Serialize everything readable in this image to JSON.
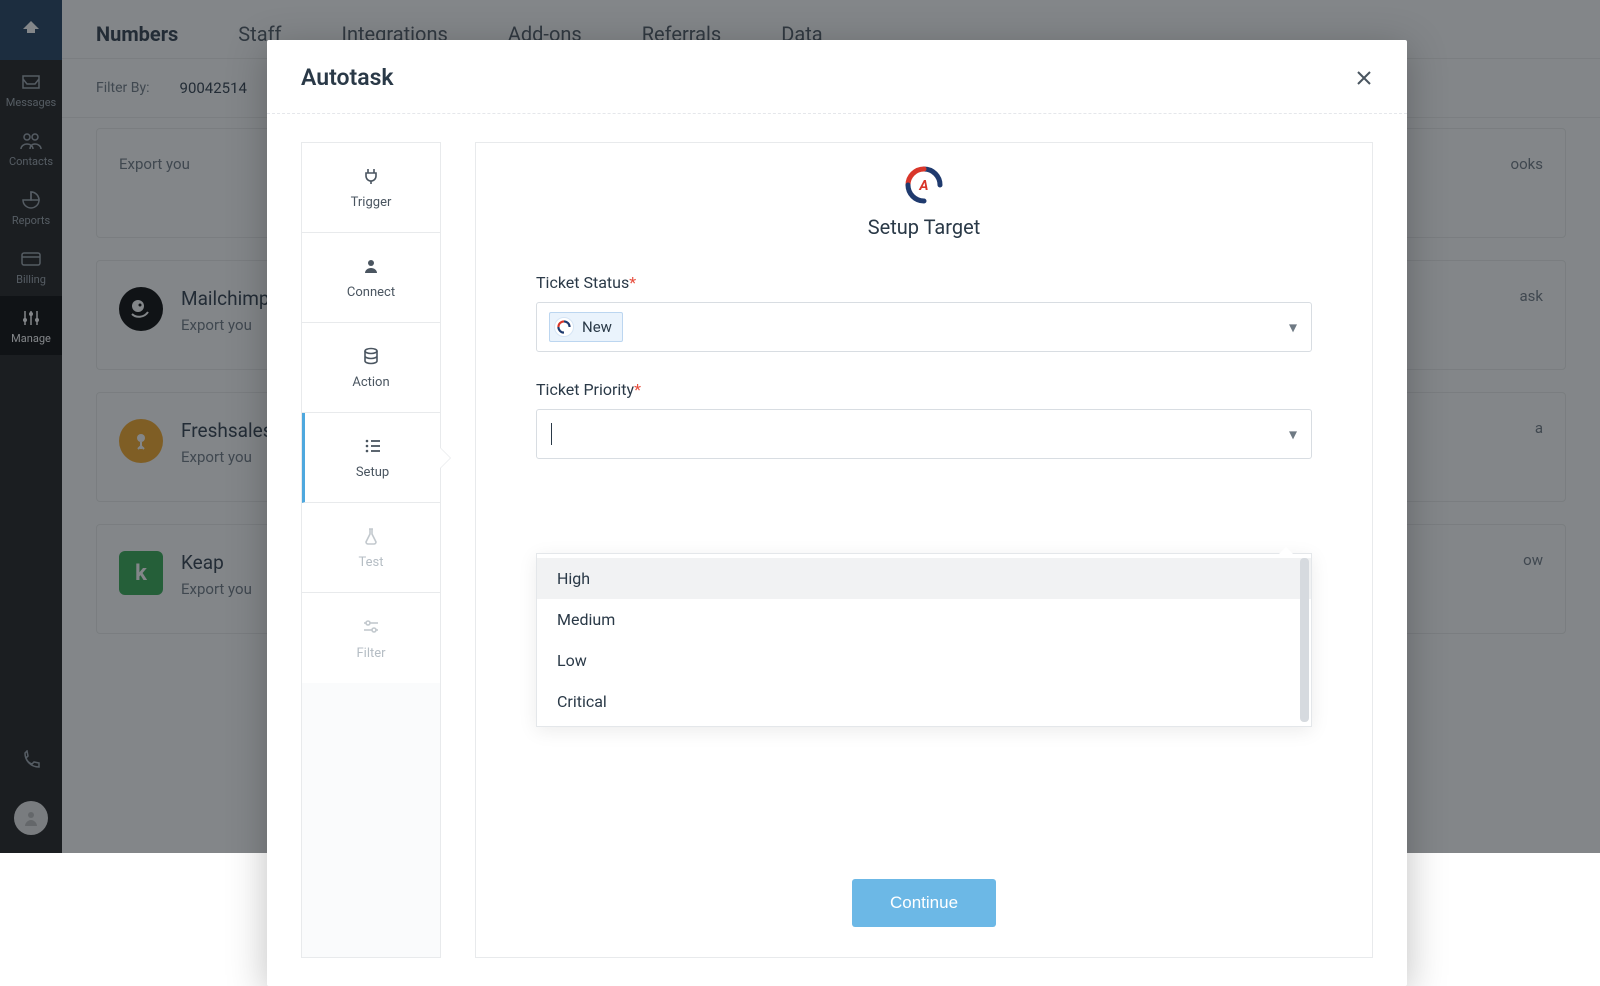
{
  "sidebar": {
    "items": [
      {
        "label": "Messages"
      },
      {
        "label": "Contacts"
      },
      {
        "label": "Reports"
      },
      {
        "label": "Billing"
      },
      {
        "label": "Manage"
      }
    ]
  },
  "topnav": {
    "tabs": [
      {
        "label": "Numbers"
      },
      {
        "label": "Staff"
      },
      {
        "label": "Integrations"
      },
      {
        "label": "Add-ons"
      },
      {
        "label": "Referrals"
      },
      {
        "label": "Data"
      }
    ]
  },
  "filter": {
    "label": "Filter By:",
    "number": "90042514"
  },
  "bgCards": {
    "rows": [
      [
        {
          "title": "",
          "desc": "Export you",
          "icon": "",
          "iconBg": ""
        },
        {
          "title": "",
          "desc": "ooks",
          "icon": "",
          "iconBg": ""
        }
      ],
      [
        {
          "title": "Mailchimp",
          "desc": "Export you",
          "icon": "mailchimp",
          "iconBg": "#000"
        },
        {
          "title": "",
          "desc": "ask",
          "icon": "",
          "iconBg": ""
        }
      ],
      [
        {
          "title": "Freshsales",
          "desc": "Export you",
          "icon": "freshsales",
          "iconBg": "#f5a623"
        },
        {
          "title": "",
          "desc": "a",
          "icon": "",
          "iconBg": ""
        }
      ],
      [
        {
          "title": "Keap",
          "desc": "Export you",
          "icon": "keap",
          "iconBg": "#2fa84f"
        },
        {
          "title": "",
          "desc": "ow",
          "icon": "",
          "iconBg": ""
        }
      ]
    ]
  },
  "modal": {
    "title": "Autotask",
    "steps": [
      {
        "label": "Trigger"
      },
      {
        "label": "Connect"
      },
      {
        "label": "Action"
      },
      {
        "label": "Setup"
      },
      {
        "label": "Test"
      },
      {
        "label": "Filter"
      }
    ],
    "panel": {
      "title": "Setup Target",
      "status_label": "Ticket Status",
      "status_value": "New",
      "priority_label": "Ticket Priority",
      "priority_options": [
        "High",
        "Medium",
        "Low",
        "Critical"
      ],
      "continue": "Continue"
    }
  }
}
